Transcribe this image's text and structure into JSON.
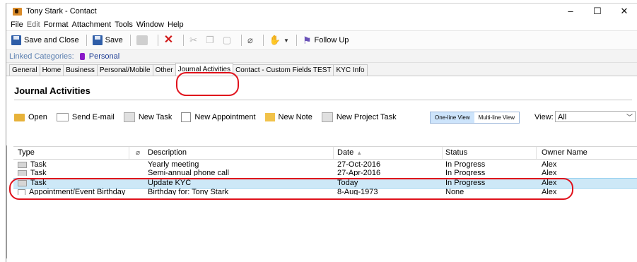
{
  "window": {
    "title": "Tony Stark - Contact",
    "controls": {
      "minimize": "–",
      "maximize": "☐",
      "close": "✕"
    }
  },
  "menu": [
    "File",
    "Edit",
    "Format",
    "Attachment",
    "Tools",
    "Window",
    "Help"
  ],
  "toolbar": {
    "save_close": "Save and Close",
    "save": "Save",
    "follow_up": "Follow Up"
  },
  "linked": {
    "label": "Linked Categories:",
    "category": "Personal",
    "category_color": "#8a19c8"
  },
  "tabs": [
    "General",
    "Home",
    "Business",
    "Personal/Mobile",
    "Other",
    "Journal Activities",
    "Contact - Custom Fields TEST",
    "KYC Info"
  ],
  "section": {
    "title": "Journal Activities"
  },
  "actions": {
    "open": "Open",
    "send_email": "Send E-mail",
    "new_task": "New Task",
    "new_appointment": "New Appointment",
    "new_note": "New Note",
    "new_project_task": "New Project Task"
  },
  "view": {
    "one_line": "One-line View",
    "multi_line": "Multi-line View",
    "label": "View:",
    "selected": "All"
  },
  "grid": {
    "headers": {
      "type": "Type",
      "description": "Description",
      "date": "Date",
      "status": "Status",
      "owner": "Owner Name"
    },
    "rows": [
      {
        "type": "Task",
        "description": "Yearly meeting",
        "date": "27-Oct-2016",
        "status": "In Progress",
        "owner": "Alex"
      },
      {
        "type": "Task",
        "description": "Semi-annual phone call",
        "date": "27-Apr-2016",
        "status": "In Progress",
        "owner": "Alex"
      },
      {
        "type": "Task",
        "description": "Update KYC",
        "date": "Today",
        "status": "In Progress",
        "owner": "Alex"
      },
      {
        "type": "Appointment/Event Birthday",
        "description": "Birthday for: Tony Stark",
        "date": "8-Aug-1973",
        "status": "None",
        "owner": "Alex"
      }
    ]
  },
  "colors": {
    "highlight": "#e0111b",
    "selected_row": "#cde8f7"
  }
}
